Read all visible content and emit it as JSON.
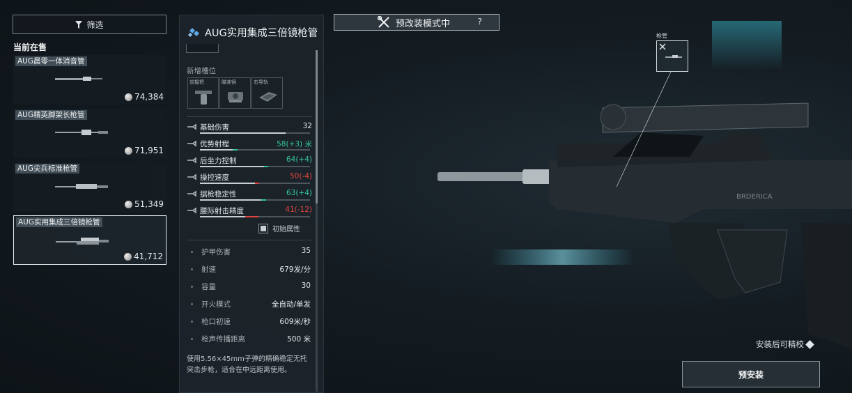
{
  "filter": {
    "label": "筛选"
  },
  "market": {
    "section_title": "当前在售",
    "items": [
      {
        "name": "AUG晨零一体消音管",
        "price": "74,384"
      },
      {
        "name": "AUG精英脚架长枪管",
        "price": "71,951"
      },
      {
        "name": "AUG尖兵标准枪管",
        "price": "51,349"
      },
      {
        "name": "AUG实用集成三倍镜枪管",
        "price": "41,712",
        "selected": true
      }
    ]
  },
  "detail": {
    "title": "AUG实用集成三倍镜枪管",
    "slots_label": "新增槽位",
    "slots": [
      {
        "label": "前握把",
        "icon": "grip-icon"
      },
      {
        "label": "瞄准镜",
        "icon": "scope-icon"
      },
      {
        "label": "右导轨",
        "icon": "rail-icon"
      }
    ],
    "stats": [
      {
        "name": "基础伤害",
        "value": "32",
        "tone": "plain",
        "level": 0.78,
        "delta": 0,
        "icon": "damage-icon"
      },
      {
        "name": "优势射程",
        "value": "58(+3) 米",
        "tone": "up",
        "level": 0.34,
        "delta": 0.04,
        "icon": "range-icon"
      },
      {
        "name": "后坐力控制",
        "value": "64(+4)",
        "tone": "up",
        "level": 0.62,
        "delta": 0.04,
        "icon": "recoil-icon"
      },
      {
        "name": "操控速度",
        "value": "50(-4)",
        "tone": "down",
        "level": 0.5,
        "delta": -0.04,
        "icon": "handling-icon"
      },
      {
        "name": "据枪稳定性",
        "value": "63(+4)",
        "tone": "up",
        "level": 0.6,
        "delta": 0.04,
        "icon": "stability-icon"
      },
      {
        "name": "腰际射击精度",
        "value": "41(-12)",
        "tone": "down",
        "level": 0.41,
        "delta": -0.12,
        "icon": "hipfire-icon"
      }
    ],
    "initial_attr_label": "初始属性",
    "attributes": [
      {
        "name": "护甲伤害",
        "value": "35"
      },
      {
        "name": "射速",
        "value": "679发/分"
      },
      {
        "name": "容量",
        "value": "30"
      },
      {
        "name": "开火模式",
        "value": "全自动/单发"
      },
      {
        "name": "枪口初速",
        "value": "609米/秒"
      },
      {
        "name": "枪声传播距离",
        "value": "500 米"
      }
    ],
    "description": "使用5.56×45mm子弹的精确稳定无托突击步枪，适合在中远距离使用。"
  },
  "mode_badge": {
    "label": "预改装模式中",
    "help": "?"
  },
  "viewport": {
    "part_label": "枪管",
    "brand_text": "BRDERICA",
    "tune_note": "安装后可精校",
    "preinstall_label": "预安装"
  },
  "colors": {
    "up": "#35c79a",
    "down": "#e2453f",
    "accent": "#d6dbde"
  }
}
